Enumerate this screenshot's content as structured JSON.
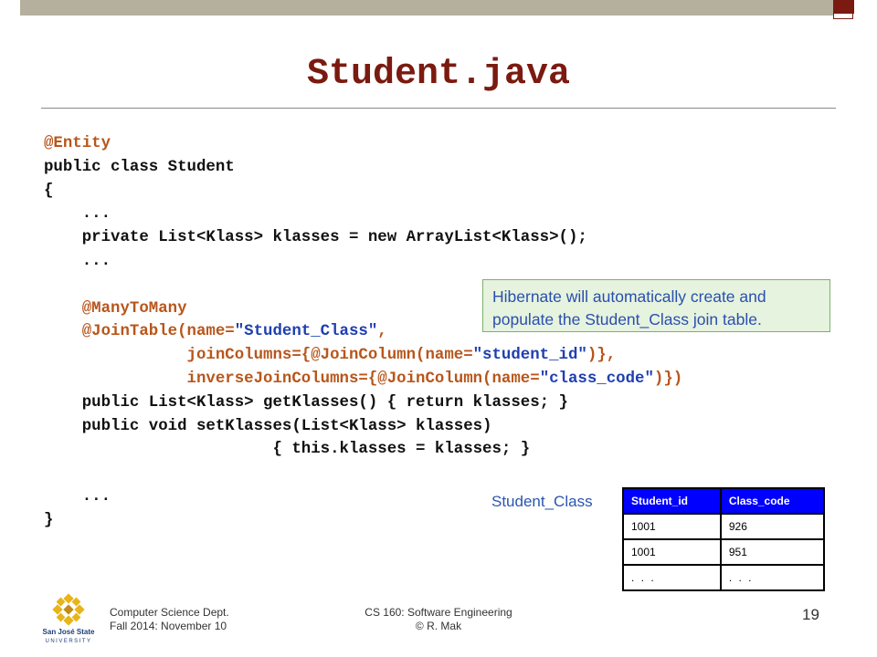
{
  "slide": {
    "title": "Student.java"
  },
  "code_lines": [
    {
      "parts": [
        {
          "t": "@Entity",
          "c": "anno"
        }
      ]
    },
    {
      "parts": [
        {
          "t": "public class Student",
          "c": ""
        }
      ]
    },
    {
      "parts": [
        {
          "t": "{",
          "c": ""
        }
      ]
    },
    {
      "parts": [
        {
          "t": "    ...",
          "c": ""
        }
      ]
    },
    {
      "parts": [
        {
          "t": "    private List<Klass> klasses = new ArrayList<Klass>();",
          "c": ""
        }
      ]
    },
    {
      "parts": [
        {
          "t": "    ...",
          "c": ""
        }
      ]
    },
    {
      "parts": [
        {
          "t": "",
          "c": ""
        }
      ]
    },
    {
      "parts": [
        {
          "t": "    @ManyToMany",
          "c": "anno"
        }
      ]
    },
    {
      "parts": [
        {
          "t": "    @JoinTable(name=",
          "c": "anno"
        },
        {
          "t": "\"Student_Class\"",
          "c": "str"
        },
        {
          "t": ",",
          "c": "anno"
        }
      ]
    },
    {
      "parts": [
        {
          "t": "               joinColumns={@JoinColumn(name=",
          "c": "anno"
        },
        {
          "t": "\"student_id\"",
          "c": "str"
        },
        {
          "t": ")},",
          "c": "anno"
        }
      ]
    },
    {
      "parts": [
        {
          "t": "               inverseJoinColumns={@JoinColumn(name=",
          "c": "anno"
        },
        {
          "t": "\"class_code\"",
          "c": "str"
        },
        {
          "t": ")})",
          "c": "anno"
        }
      ]
    },
    {
      "parts": [
        {
          "t": "    public List<Klass> getKlasses() { return klasses; }",
          "c": ""
        }
      ]
    },
    {
      "parts": [
        {
          "t": "    public void setKlasses(List<Klass> klasses)",
          "c": ""
        }
      ]
    },
    {
      "parts": [
        {
          "t": "                        { this.klasses = klasses; }",
          "c": ""
        }
      ]
    },
    {
      "parts": [
        {
          "t": "",
          "c": ""
        }
      ]
    },
    {
      "parts": [
        {
          "t": "    ...",
          "c": ""
        }
      ]
    },
    {
      "parts": [
        {
          "t": "}",
          "c": ""
        }
      ]
    }
  ],
  "callout": {
    "line1": "Hibernate will automatically create and",
    "line2_before": "populate the ",
    "line2_name": "Student_Class",
    "line2_after": " join table."
  },
  "join_table": {
    "caption": "Student_Class",
    "headers": [
      "Student_id",
      "Class_code"
    ],
    "rows": [
      [
        "1001",
        "926"
      ],
      [
        "1001",
        "951"
      ],
      [
        ". . .",
        ". . ."
      ]
    ]
  },
  "footer": {
    "left_line1": "Computer Science Dept.",
    "left_line2": "Fall 2014: November 10",
    "center_line1": "CS 160: Software Engineering",
    "center_line2": "© R. Mak",
    "page_number": "19"
  },
  "logo": {
    "icon": "sjsu-logo-icon",
    "text_line1": "San José State",
    "text_line2": "UNIVERSITY"
  },
  "colors": {
    "title": "#7b1a10",
    "annotation": "#b8561b",
    "string": "#1f3fb0",
    "table_header": "#0000ff",
    "callout_bg": "#e6f3df"
  }
}
